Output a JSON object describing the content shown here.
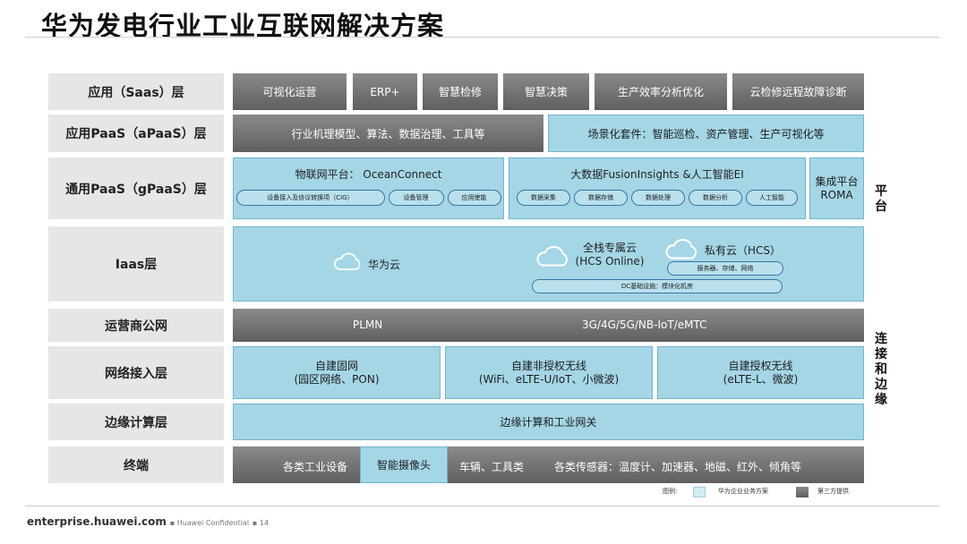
{
  "title": "华为发电行业工业互联网解决方案",
  "layers": {
    "saas": "应用（Saas）层",
    "apaas": "应用PaaS（aPaaS）层",
    "gpaas": "通用PaaS（gPaaS）层",
    "iaas": "Iaas层",
    "operator": "运营商公网",
    "access": "网络接入层",
    "edge": "边缘计算层",
    "terminal": "终端"
  },
  "saas_apps": [
    "可视化运营",
    "ERP+",
    "智慧检修",
    "智慧决策",
    "生产效率分析优化",
    "云检修远程故障诊断"
  ],
  "apaas": {
    "left": "行业机理模型、算法、数据治理、工具等",
    "right": "场景化套件：智能巡检、资产管理、生产可视化等"
  },
  "gpaas": {
    "iot_title": "物联网平台：  OceanConnect",
    "iot_items": [
      "设备接入及协议转换项（CIG）",
      "设备管理",
      "应用使能"
    ],
    "bigdata_title": "大数据FusionInsights &人工智能EI",
    "bigdata_items": [
      "数据采集",
      "数据存储",
      "数据处理",
      "数据分析",
      "人工智能"
    ],
    "roma_line1": "集成平台",
    "roma_line2": "ROMA"
  },
  "iaas": {
    "huawei_cloud": "华为云",
    "dedicated_line1": "全栈专属云",
    "dedicated_line2": "(HCS Online)",
    "private_cloud": "私有云（HCS）",
    "private_items": "服务器、存储、网络",
    "dc": "DC基础设施：模块化机房"
  },
  "operator": {
    "plmn": "PLMN",
    "tech": "3G/4G/5G/NB-IoT/eMTC"
  },
  "access": [
    {
      "line1": "自建固网",
      "line2": "(园区网络、PON)"
    },
    {
      "line1": "自建非授权无线",
      "line2": "(WiFi、eLTE-U/IoT、小微波)"
    },
    {
      "line1": "自建授权无线",
      "line2": "(eLTE-L、微波)"
    }
  ],
  "edge": "边缘计算和工业网关",
  "terminal": {
    "industrial": "各类工业设备",
    "camera": "智能摄像头",
    "vehicles": "车辆、工具类",
    "sensors": "各类传感器：温度计、加速器、地磁、红外、倾角等"
  },
  "side": {
    "platform": [
      "平",
      "台"
    ],
    "connect": [
      "连",
      "接",
      "和",
      "边",
      "缘"
    ]
  },
  "legend": {
    "label": "图例:",
    "huawei": "华为企业业务方案",
    "third": "第三方提供"
  },
  "footer": {
    "site": "enterprise.huawei.com",
    "conf": "Huawei Confidential",
    "page": "14"
  },
  "colors": {
    "huawei_blue": "#a5d6e6",
    "third_party_gray": "#6f6f6f",
    "label_bg": "#e6e6e6"
  }
}
